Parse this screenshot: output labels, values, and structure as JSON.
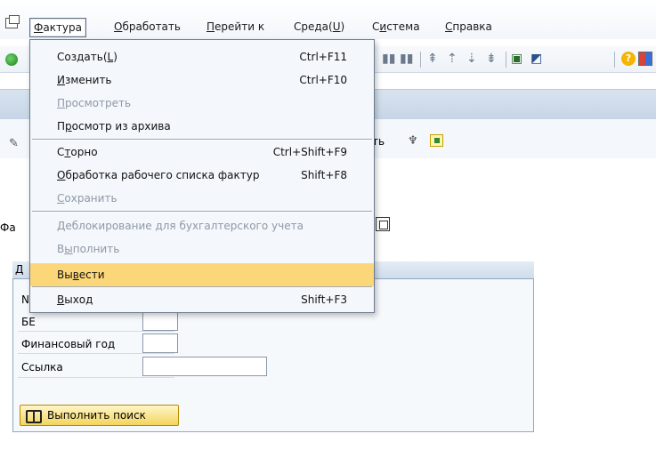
{
  "menubar": {
    "items": [
      {
        "label": "Фактура",
        "ul": "Ф",
        "rest": "актура"
      },
      {
        "label": "Обработать",
        "ul": "О",
        "rest": "бработать"
      },
      {
        "label": "Перейти к",
        "ul": "П",
        "rest": "ерейти к"
      },
      {
        "pre": "Среда(",
        "ul": "U",
        "post": ")"
      },
      {
        "pre": "С",
        "ul": "и",
        "post": "стема"
      },
      {
        "label": "Справка",
        "ul": "С",
        "rest": "правка"
      }
    ]
  },
  "dropdown": {
    "items": [
      {
        "pre": "Создать(",
        "ul": "L",
        "post": ")",
        "shortcut": "Ctrl+F11",
        "disabled": false
      },
      {
        "pre": "",
        "ul": "И",
        "post": "зменить",
        "shortcut": "Ctrl+F10",
        "disabled": false
      },
      {
        "pre": "",
        "ul": "П",
        "post": "росмотреть",
        "shortcut": "",
        "disabled": true
      },
      {
        "pre": "П",
        "ul": "р",
        "post": "осмотр из архива",
        "shortcut": "",
        "disabled": false
      },
      {
        "pre": "С",
        "ul": "т",
        "post": "орно",
        "shortcut": "Ctrl+Shift+F9",
        "disabled": false
      },
      {
        "pre": "",
        "ul": "О",
        "post": "бработка рабочего списка фактур",
        "shortcut": "Shift+F8",
        "disabled": false
      },
      {
        "pre": "",
        "ul": "С",
        "post": "охранить",
        "shortcut": "",
        "disabled": true
      },
      {
        "pre": "",
        "ul": "Д",
        "post": "еблокирование для бухгалтерского учета",
        "shortcut": "",
        "disabled": true
      },
      {
        "pre": "В",
        "ul": "ы",
        "post": "полнить",
        "shortcut": "",
        "disabled": true
      },
      {
        "pre": "Вы",
        "ul": "в",
        "post": "ести",
        "shortcut": "",
        "disabled": false,
        "highlighted": true
      },
      {
        "pre": "",
        "ul": "В",
        "post": "ыход",
        "shortcut": "Shift+F3",
        "disabled": false
      }
    ]
  },
  "apptoolbar": {
    "partial_label": "ть"
  },
  "form": {
    "partial_field_label": "Фа"
  },
  "group": {
    "title_partial": "Д",
    "fields": [
      {
        "label": "N",
        "value": ""
      },
      {
        "label": "БЕ",
        "value": ""
      },
      {
        "label": "Финансовый год",
        "value": ""
      },
      {
        "label": "Ссылка",
        "value": ""
      }
    ],
    "search_button": "Выполнить поиск"
  },
  "colors": {
    "menu_highlight": "#fcd77a",
    "title_bar": "#c6d5e6",
    "group_border": "#93a7bf",
    "search_button": "#f3d45c"
  }
}
